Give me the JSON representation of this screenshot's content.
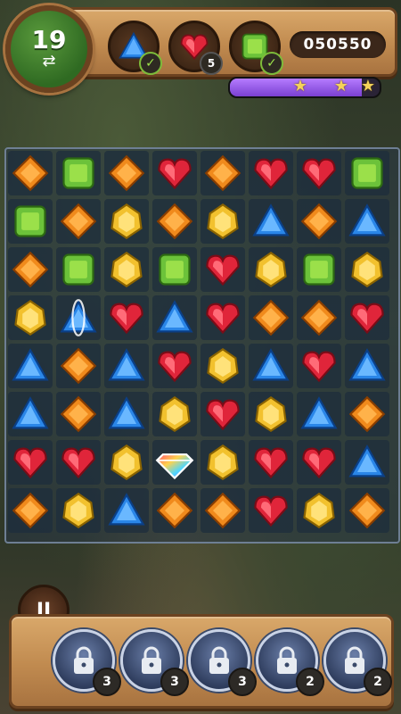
{
  "hud": {
    "moves_left": "19",
    "swap_icon": "⇄",
    "score": "050550",
    "progress_fraction": 0.88,
    "stars": [
      "★",
      "★",
      "★"
    ],
    "goals": [
      {
        "gem": "blue",
        "status": "done",
        "badge": "✓"
      },
      {
        "gem": "red",
        "status": "remaining",
        "badge": "5"
      },
      {
        "gem": "green",
        "status": "done",
        "badge": "✓"
      }
    ]
  },
  "board": {
    "rows": [
      [
        "orange",
        "green",
        "orange",
        "red",
        "orange",
        "red",
        "red",
        "green"
      ],
      [
        "green",
        "orange",
        "yellow",
        "orange",
        "yellow",
        "blue",
        "orange",
        "blue"
      ],
      [
        "orange",
        "green",
        "yellow",
        "green",
        "red",
        "yellow",
        "green",
        "yellow"
      ],
      [
        "yellow",
        "blue_special",
        "red",
        "blue",
        "red",
        "orange",
        "orange",
        "red"
      ],
      [
        "blue",
        "orange",
        "blue",
        "red",
        "yellow",
        "blue",
        "red",
        "blue"
      ],
      [
        "blue",
        "orange",
        "blue",
        "yellow",
        "red",
        "yellow",
        "blue",
        "orange"
      ],
      [
        "red",
        "red",
        "yellow",
        "rainbow",
        "yellow",
        "red",
        "red",
        "blue"
      ],
      [
        "orange",
        "yellow",
        "blue",
        "orange",
        "orange",
        "red",
        "yellow",
        "orange"
      ]
    ]
  },
  "controls": {
    "pause_label": "II",
    "boosters": [
      {
        "name": "booster-1",
        "count": "3",
        "locked": true
      },
      {
        "name": "booster-2",
        "count": "3",
        "locked": true
      },
      {
        "name": "booster-3",
        "count": "3",
        "locked": true
      },
      {
        "name": "booster-4",
        "count": "2",
        "locked": true
      },
      {
        "name": "booster-5",
        "count": "2",
        "locked": true
      }
    ]
  },
  "colors": {
    "orange": "#f08a1c",
    "green": "#6cc23a",
    "red": "#e0253a",
    "yellow": "#f2c12e",
    "blue": "#2a86e8"
  }
}
